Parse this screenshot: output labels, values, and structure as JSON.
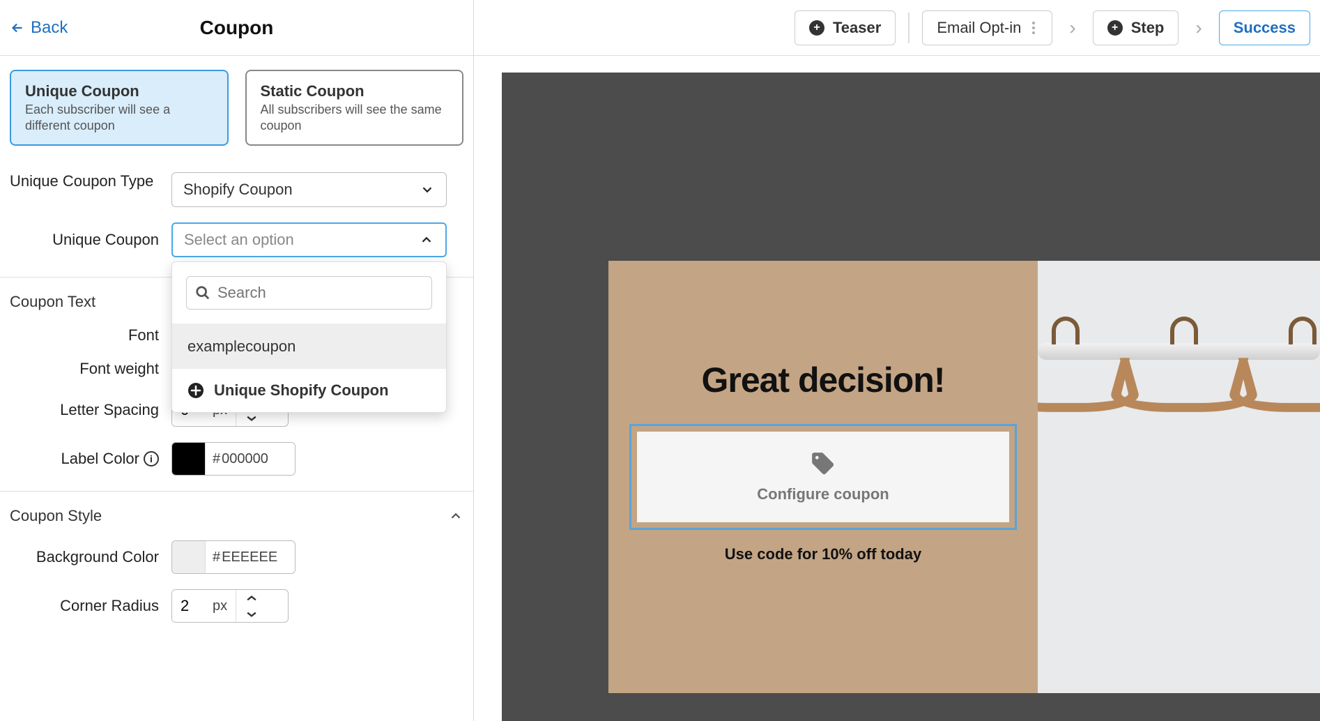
{
  "header": {
    "back_label": "Back",
    "title": "Coupon"
  },
  "coupon_cards": {
    "unique": {
      "title": "Unique Coupon",
      "desc": "Each subscriber will see a different coupon"
    },
    "static": {
      "title": "Static Coupon",
      "desc": "All subscribers will see the same coupon"
    }
  },
  "fields": {
    "type_label": "Unique Coupon Type",
    "type_value": "Shopify Coupon",
    "select_label": "Unique Coupon",
    "select_placeholder": "Select an option",
    "search_placeholder": "Search",
    "option1": "examplecoupon",
    "option_add": "Unique Shopify Coupon"
  },
  "sections": {
    "coupon_text": "Coupon Text",
    "coupon_style": "Coupon Style",
    "font_label": "Font",
    "font_weight_label": "Font weight",
    "letter_spacing_label": "Letter Spacing",
    "letter_spacing_value": "0",
    "letter_spacing_unit": "px",
    "label_color_label": "Label Color",
    "label_color_hex": "000000",
    "bg_color_label": "Background Color",
    "bg_color_hex": "EEEEEE",
    "corner_radius_label": "Corner Radius",
    "corner_radius_value": "2",
    "corner_radius_unit": "px"
  },
  "stepper_bar": {
    "teaser": "Teaser",
    "email_optin": "Email Opt-in",
    "step": "Step",
    "success": "Success"
  },
  "preview": {
    "headline": "Great decision!",
    "configure": "Configure coupon",
    "subtext": "Use code for 10% off today"
  },
  "colors": {
    "label": "#000000",
    "bg": "#EEEEEE"
  }
}
